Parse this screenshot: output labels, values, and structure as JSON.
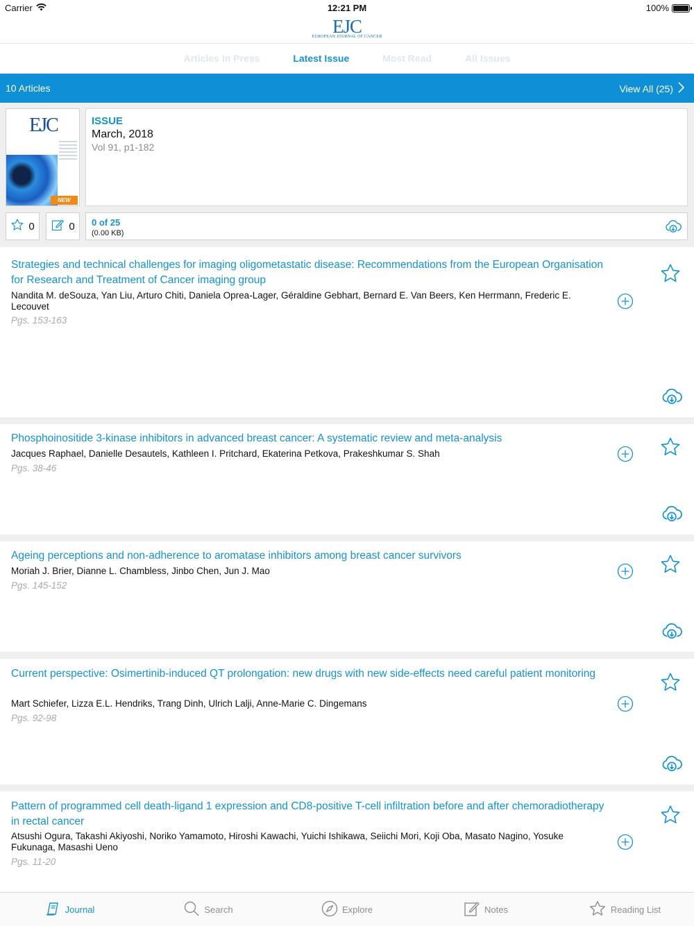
{
  "status": {
    "carrier": "Carrier",
    "time": "12:21 PM",
    "battery": "100%"
  },
  "logo": {
    "mark": "EJC",
    "sub": "European Journal of Cancer"
  },
  "tabs": [
    {
      "label": "Articles In Press"
    },
    {
      "label": "Latest Issue"
    },
    {
      "label": "Most Read"
    },
    {
      "label": "All Issues"
    }
  ],
  "active_tab": "Latest Issue",
  "bar": {
    "count": "10 Articles",
    "view_all": "View All (25)"
  },
  "issue": {
    "label": "ISSUE",
    "date": "March, 2018",
    "volume": "Vol 91, p1-182",
    "cover_title": "EJC",
    "badge": "NEW",
    "favorites": "0",
    "notes": "0",
    "progress": "0 of 25",
    "size": "(0.00 KB)"
  },
  "articles": [
    {
      "title": "Strategies and technical challenges for imaging oligometastatic disease: Recommendations from the European Organisation for Research and Treatment of Cancer imaging group",
      "authors": "Nandita M. deSouza, Yan Liu, Arturo Chiti, Daniela Oprea-Lager, Géraldine Gebhart, Bernard E. Van Beers, Ken Herrmann, Frederic E. Lecouvet",
      "pages": "Pgs. 153-163"
    },
    {
      "title": "Phosphoinositide 3-kinase inhibitors in advanced breast cancer: A systematic review and meta-analysis",
      "authors": "Jacques Raphael, Danielle Desautels, Kathleen I. Pritchard, Ekaterina Petkova, Prakeshkumar S. Shah",
      "pages": "Pgs. 38-46"
    },
    {
      "title": "Ageing perceptions and non-adherence to aromatase inhibitors among breast cancer survivors",
      "authors": "Moriah J. Brier, Dianne L. Chambless, Jinbo Chen, Jun J. Mao",
      "pages": "Pgs. 145-152"
    },
    {
      "title": "Current perspective: Osimertinib-induced QT prolongation: new drugs with new side-effects need careful patient monitoring",
      "authors": "Mart Schiefer, Lizza E.L. Hendriks, Trang Dinh, Ulrich Lalji, Anne-Marie C. Dingemans",
      "pages": "Pgs. 92-98"
    },
    {
      "title": "Pattern of programmed cell death-ligand 1 expression and CD8-positive T-cell infiltration before and after chemoradiotherapy in rectal cancer",
      "authors": "Atsushi Ogura, Takashi Akiyoshi, Noriko Yamamoto, Hiroshi Kawachi, Yuichi Ishikawa, Seiichi Mori, Koji Oba, Masato Nagino, Yosuke Fukunaga, Masashi Ueno",
      "pages": "Pgs. 11-20"
    }
  ],
  "bottom_nav": [
    {
      "label": "Journal",
      "icon": "journal-icon"
    },
    {
      "label": "Search",
      "icon": "search-icon"
    },
    {
      "label": "Explore",
      "icon": "compass-icon"
    },
    {
      "label": "Notes",
      "icon": "notes-icon"
    },
    {
      "label": "Reading List",
      "icon": "star-icon"
    }
  ],
  "colors": {
    "accent": "#1592d3",
    "bar": "#0f8fd6",
    "badge": "#f08a16",
    "muted": "#aaaaaa"
  }
}
